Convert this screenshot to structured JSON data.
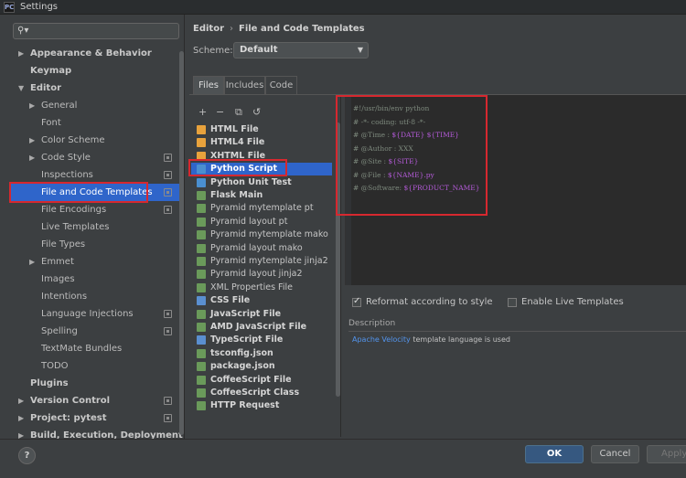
{
  "window": {
    "title": "Settings",
    "app_icon": "PC"
  },
  "search": {
    "placeholder": ""
  },
  "sidebar": {
    "items": [
      {
        "label": "Appearance & Behavior",
        "arrow": "▶",
        "bold": true
      },
      {
        "label": "Keymap",
        "arrow": "",
        "bold": true
      },
      {
        "label": "Editor",
        "arrow": "▼",
        "bold": true
      },
      {
        "label": "General",
        "arrow": "▶",
        "bold": false
      },
      {
        "label": "Font",
        "arrow": "",
        "bold": false
      },
      {
        "label": "Color Scheme",
        "arrow": "▶",
        "bold": false
      },
      {
        "label": "Code Style",
        "arrow": "▶",
        "bold": false,
        "project_icon": true
      },
      {
        "label": "Inspections",
        "arrow": "",
        "bold": false,
        "project_icon": true
      },
      {
        "label": "File and Code Templates",
        "arrow": "",
        "bold": false,
        "project_icon": true,
        "selected": true
      },
      {
        "label": "File Encodings",
        "arrow": "",
        "bold": false,
        "project_icon": true
      },
      {
        "label": "Live Templates",
        "arrow": "",
        "bold": false
      },
      {
        "label": "File Types",
        "arrow": "",
        "bold": false
      },
      {
        "label": "Emmet",
        "arrow": "▶",
        "bold": false
      },
      {
        "label": "Images",
        "arrow": "",
        "bold": false
      },
      {
        "label": "Intentions",
        "arrow": "",
        "bold": false
      },
      {
        "label": "Language Injections",
        "arrow": "",
        "bold": false,
        "project_icon": true
      },
      {
        "label": "Spelling",
        "arrow": "",
        "bold": false,
        "project_icon": true
      },
      {
        "label": "TextMate Bundles",
        "arrow": "",
        "bold": false
      },
      {
        "label": "TODO",
        "arrow": "",
        "bold": false
      },
      {
        "label": "Plugins",
        "arrow": "",
        "bold": true
      },
      {
        "label": "Version Control",
        "arrow": "▶",
        "bold": true,
        "project_icon": true
      },
      {
        "label": "Project: pytest",
        "arrow": "▶",
        "bold": true,
        "project_icon": true
      },
      {
        "label": "Build, Execution, Deployment",
        "arrow": "▶",
        "bold": true
      }
    ]
  },
  "breadcrumb": {
    "parent": "Editor",
    "separator": "›",
    "current": "File and Code Templates"
  },
  "scheme": {
    "label": "Scheme:",
    "value": "Default"
  },
  "tabs": [
    {
      "label": "Files",
      "active": true
    },
    {
      "label": "Includes",
      "active": false
    },
    {
      "label": "Code",
      "active": false
    }
  ],
  "toolbar": {
    "add": "+",
    "remove": "−",
    "copy": "⧉",
    "reset": "↺"
  },
  "files": [
    {
      "name": "HTML File",
      "bold": true,
      "color": "#e8a23c"
    },
    {
      "name": "HTML4 File",
      "bold": true,
      "color": "#e8a23c"
    },
    {
      "name": "XHTML File",
      "bold": true,
      "color": "#e8a23c"
    },
    {
      "name": "Python Script",
      "bold": true,
      "color": "#4a8fd0",
      "selected": true
    },
    {
      "name": "Python Unit Test",
      "bold": true,
      "color": "#4a8fd0"
    },
    {
      "name": "Flask Main",
      "bold": true,
      "color": "#6a9a5a"
    },
    {
      "name": "Pyramid mytemplate pt",
      "bold": false,
      "color": "#6a9a5a"
    },
    {
      "name": "Pyramid layout pt",
      "bold": false,
      "color": "#6a9a5a"
    },
    {
      "name": "Pyramid mytemplate mako",
      "bold": false,
      "color": "#6a9a5a"
    },
    {
      "name": "Pyramid layout mako",
      "bold": false,
      "color": "#6a9a5a"
    },
    {
      "name": "Pyramid mytemplate jinja2",
      "bold": false,
      "color": "#6a9a5a"
    },
    {
      "name": "Pyramid layout jinja2",
      "bold": false,
      "color": "#6a9a5a"
    },
    {
      "name": "XML Properties File",
      "bold": false,
      "color": "#6a9a5a"
    },
    {
      "name": "CSS File",
      "bold": true,
      "color": "#5a8fd0"
    },
    {
      "name": "JavaScript File",
      "bold": true,
      "color": "#6a9a5a"
    },
    {
      "name": "AMD JavaScript File",
      "bold": true,
      "color": "#6a9a5a"
    },
    {
      "name": "TypeScript File",
      "bold": true,
      "color": "#5a8fd0"
    },
    {
      "name": "tsconfig.json",
      "bold": true,
      "color": "#6a9a5a"
    },
    {
      "name": "package.json",
      "bold": true,
      "color": "#6a9a5a"
    },
    {
      "name": "CoffeeScript File",
      "bold": true,
      "color": "#6a9a5a"
    },
    {
      "name": "CoffeeScript Class",
      "bold": true,
      "color": "#6a9a5a"
    },
    {
      "name": "HTTP Request",
      "bold": true,
      "color": "#6a9a5a"
    }
  ],
  "editor": {
    "lines": [
      {
        "text": "#!/usr/bin/env python",
        "var": ""
      },
      {
        "text": "# -*- coding: utf-8 -*-",
        "var": ""
      },
      {
        "text": "# @Time : ",
        "var": "${DATE} ${TIME}"
      },
      {
        "text": "# @Author : XXX",
        "var": ""
      },
      {
        "text": "# @Site : ",
        "var": "${SITE}"
      },
      {
        "text": "# @File : ",
        "var": "${NAME}.py"
      },
      {
        "text": "# @Software: ",
        "var": "${PRODUCT_NAME}"
      }
    ]
  },
  "options": {
    "reformat": {
      "label": "Reformat according to style",
      "checked": true
    },
    "live_templates": {
      "label": "Enable Live Templates",
      "checked": false
    }
  },
  "description": {
    "label": "Description",
    "link": "Apache Velocity",
    "text": " template language is used"
  },
  "footer": {
    "help": "?",
    "ok": "OK",
    "cancel": "Cancel",
    "apply": "Apply"
  },
  "colors": {
    "selection": "#2f65ca",
    "highlight_border": "#d6282f",
    "link": "#5394ec"
  }
}
